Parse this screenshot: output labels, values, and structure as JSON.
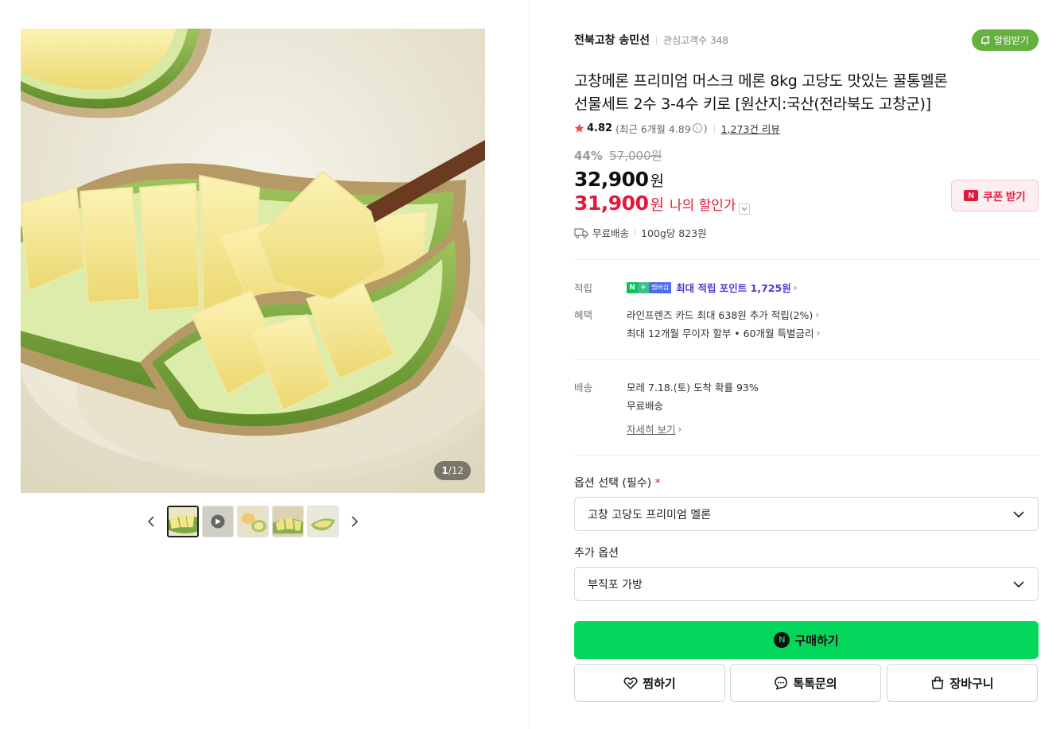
{
  "gallery": {
    "counter_current": "1",
    "counter_total": "/12",
    "thumb_count": 5
  },
  "store": {
    "name": "전북고창 송민선",
    "fans_label": "관심고객수 348",
    "alarm_label": "알림받기"
  },
  "product": {
    "title_line1": "고창메론 프리미엄 머스크 메론 8kg 고당도 맛있는 꿀통멜론",
    "title_line2": "선물세트 2수 3-4수 키로 [원산지:국산(전라북도 고창군)]",
    "rating": "4.82",
    "recent_prefix": "(최근 6개월 4.89",
    "recent_suffix": ")",
    "review_link": "1,273건 리뷰",
    "discount_pct": "44%",
    "original_price": "57,000원",
    "price": "32,900",
    "price_unit": "원",
    "my_price": "31,900",
    "my_price_unit": "원",
    "my_price_label": "나의 할인가",
    "coupon_label": "쿠폰 받기",
    "free_shipping": "무료배송",
    "unit_price": "100g당 823원"
  },
  "benefits": {
    "points_label": "적립",
    "membership_badge": "멤버십",
    "points_text": "최대 적립 포인트 ",
    "points_amount": "1,725원",
    "benefit_label": "혜택",
    "card_text": "라인프렌즈 카드 최대 638원 추가 적립(2%)",
    "installment_text": "최대 12개월 무이자 할부 • 60개월 특별금리",
    "delivery_label": "배송",
    "arrival_text": "모레 7.18.(토) 도착 확률 93%",
    "delivery_fee": "무료배송",
    "detail_link": "자세히 보기"
  },
  "options": {
    "required_label": "옵션 선택 (필수)",
    "required_mark": "*",
    "selected_option": "고창 고당도 프리미엄 멜론",
    "extra_label": "추가 옵션",
    "extra_selected": "부직포 가방"
  },
  "actions": {
    "buy_label": "구매하기",
    "wish_label": "찜하기",
    "talk_label": "톡톡문의",
    "cart_label": "장바구니"
  },
  "colors": {
    "buy_green": "#05d75c",
    "sale_red": "#e3183d",
    "points_purple": "#5a33d6",
    "alarm_green": "#64b140"
  }
}
